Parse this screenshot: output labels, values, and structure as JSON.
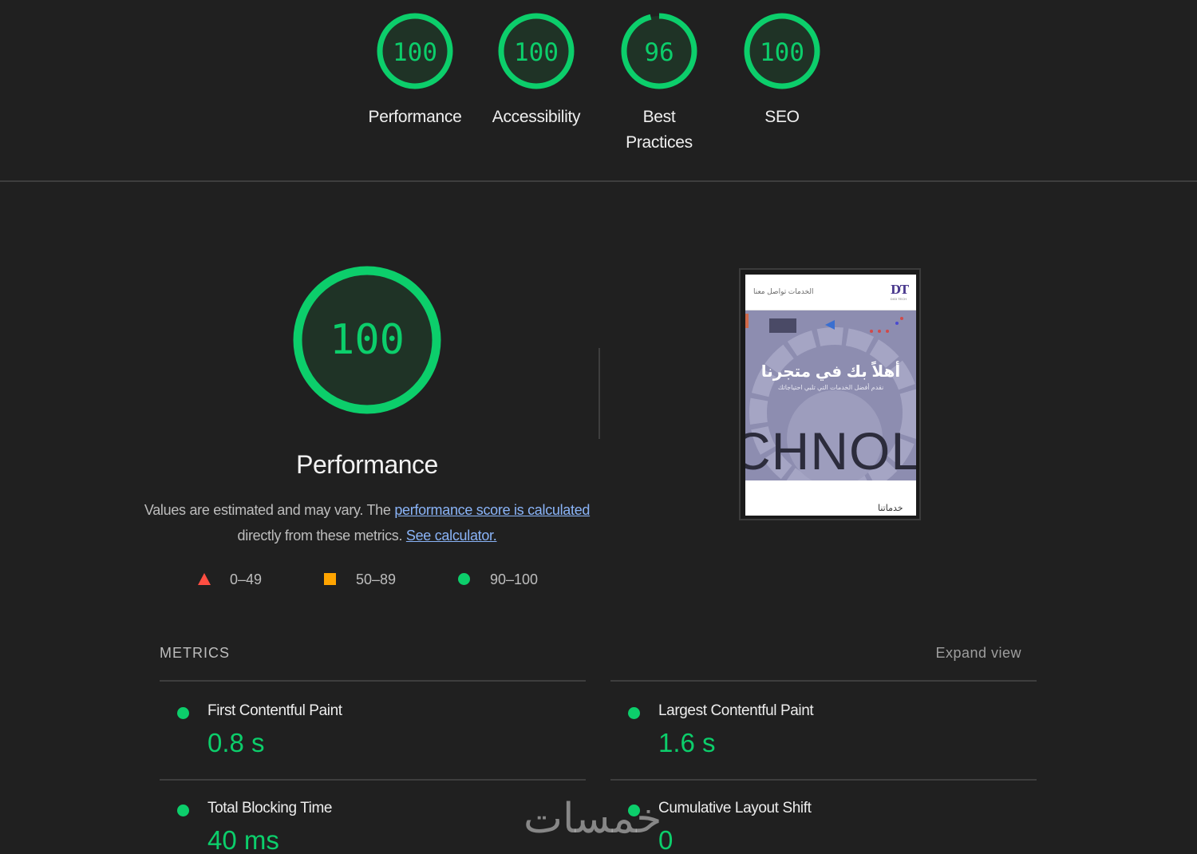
{
  "colors": {
    "background": "#202020",
    "pass": "#0cce6b",
    "average": "#ffa400",
    "fail": "#ff4e42",
    "link": "#8ab4f8"
  },
  "gauges": [
    {
      "label": "Performance",
      "value": "100",
      "score": 100
    },
    {
      "label": "Accessibility",
      "value": "100",
      "score": 100
    },
    {
      "label": "Best Practices",
      "value": "96",
      "score": 96
    },
    {
      "label": "SEO",
      "value": "100",
      "score": 100
    }
  ],
  "performance": {
    "value": "100",
    "score": 100,
    "title": "Performance",
    "desc_prefix": "Values are estimated and may vary. The ",
    "desc_link1": "performance score is calculated",
    "desc_middle": " directly from these metrics. ",
    "desc_link2": "See calculator."
  },
  "legend": [
    {
      "shape": "triangle",
      "label": "0–49"
    },
    {
      "shape": "square",
      "label": "50–89"
    },
    {
      "shape": "circle",
      "label": "90–100"
    }
  ],
  "thumbnail": {
    "nav": "الخدمات   تواصل معنا",
    "logo": "DT",
    "logo_sub": "DIGI TECH",
    "hero_title": "أهلاً بك في متجرنا",
    "hero_sub": "نقدم أفضل الخدمات التي تلبي احتياجاتك",
    "big_text": "CHNOLO",
    "footer_text": "خدماتنا"
  },
  "metrics": {
    "title": "METRICS",
    "expand": "Expand view",
    "items": [
      {
        "label": "First Contentful Paint",
        "value": "0.8 s"
      },
      {
        "label": "Largest Contentful Paint",
        "value": "1.6 s"
      },
      {
        "label": "Total Blocking Time",
        "value": "40 ms"
      },
      {
        "label": "Cumulative Layout Shift",
        "value": "0"
      }
    ]
  },
  "watermark": "خمسات"
}
